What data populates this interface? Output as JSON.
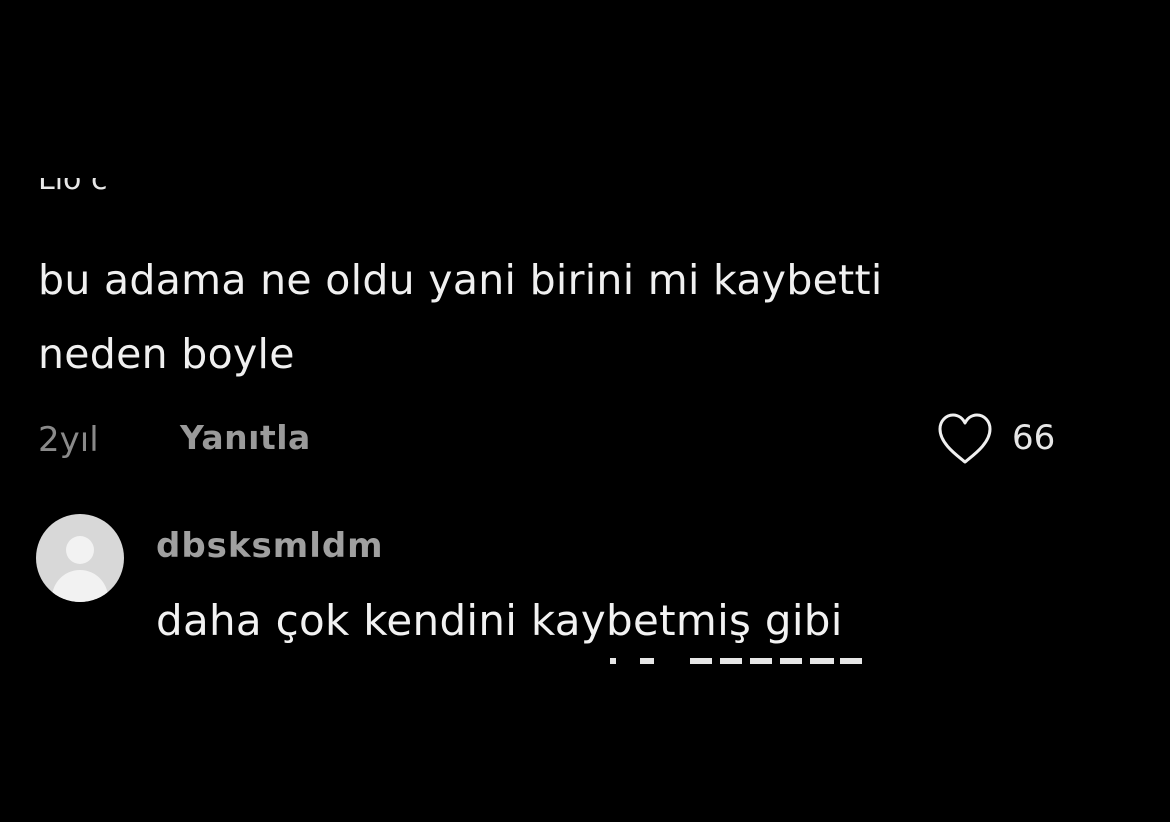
{
  "comment": {
    "clipped_previous_text": "Lio c",
    "text_line1": "bu adama ne oldu yani birini mi kaybetti",
    "text_line2": "neden boyle",
    "time": "2yıl",
    "reply_label": "Yanıtla",
    "like_count": "66"
  },
  "reply": {
    "username": "dbsksmldm",
    "text": "daha çok kendini kaybetmiş gibi"
  },
  "icons": {
    "like": "heart-outline-icon",
    "avatar": "default-avatar-icon"
  },
  "colors": {
    "background": "#000000",
    "text": "#f0f0f0",
    "muted": "#8a8a8a"
  }
}
